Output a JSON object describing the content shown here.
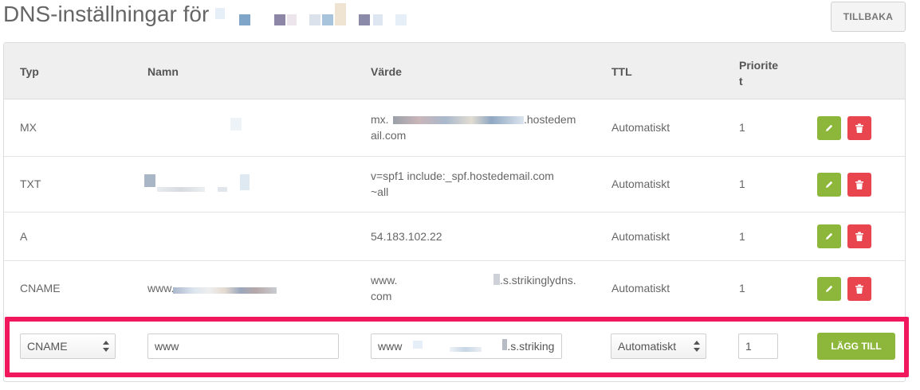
{
  "page": {
    "title": "DNS-inställningar för",
    "back_label": "TILLBAKA"
  },
  "table": {
    "headers": {
      "type": "Typ",
      "name": "Namn",
      "value": "Värde",
      "ttl": "TTL",
      "priority_line1": "Priorite",
      "priority_line2": "t"
    },
    "rows": [
      {
        "type": "MX",
        "name": "",
        "value_line1": "mx.",
        "value_line1_suffix": ".hostedem",
        "value_line2": "ail.com",
        "ttl": "Automatiskt",
        "priority": "1"
      },
      {
        "type": "TXT",
        "name": "",
        "value_line1": "v=spf1 include:_spf.hostedemail.com",
        "value_line2": "~all",
        "ttl": "Automatiskt",
        "priority": "1"
      },
      {
        "type": "A",
        "name": "",
        "value_line1": "54.183.102.22",
        "value_line2": "",
        "ttl": "Automatiskt",
        "priority": "1"
      },
      {
        "type": "CNAME",
        "name": "www.",
        "value_line1": "www.",
        "value_line1_suffix": ".s.strikinglydns.",
        "value_line2": "com",
        "ttl": "Automatiskt",
        "priority": "1"
      }
    ]
  },
  "add_form": {
    "type_selected": "CNAME",
    "name_value": "www",
    "value_prefix": "www",
    "value_suffix": ".s.striking",
    "ttl_selected": "Automatiskt",
    "priority_value": "1",
    "add_label": "LÄGG TILL"
  },
  "icons": {
    "edit": "pencil-icon",
    "delete": "trash-icon",
    "select": "select-arrows-icon"
  },
  "colors": {
    "edit_button": "#8cb73a",
    "delete_button": "#e8454e",
    "highlight_border": "#f0175c",
    "header_background": "#efefef"
  }
}
